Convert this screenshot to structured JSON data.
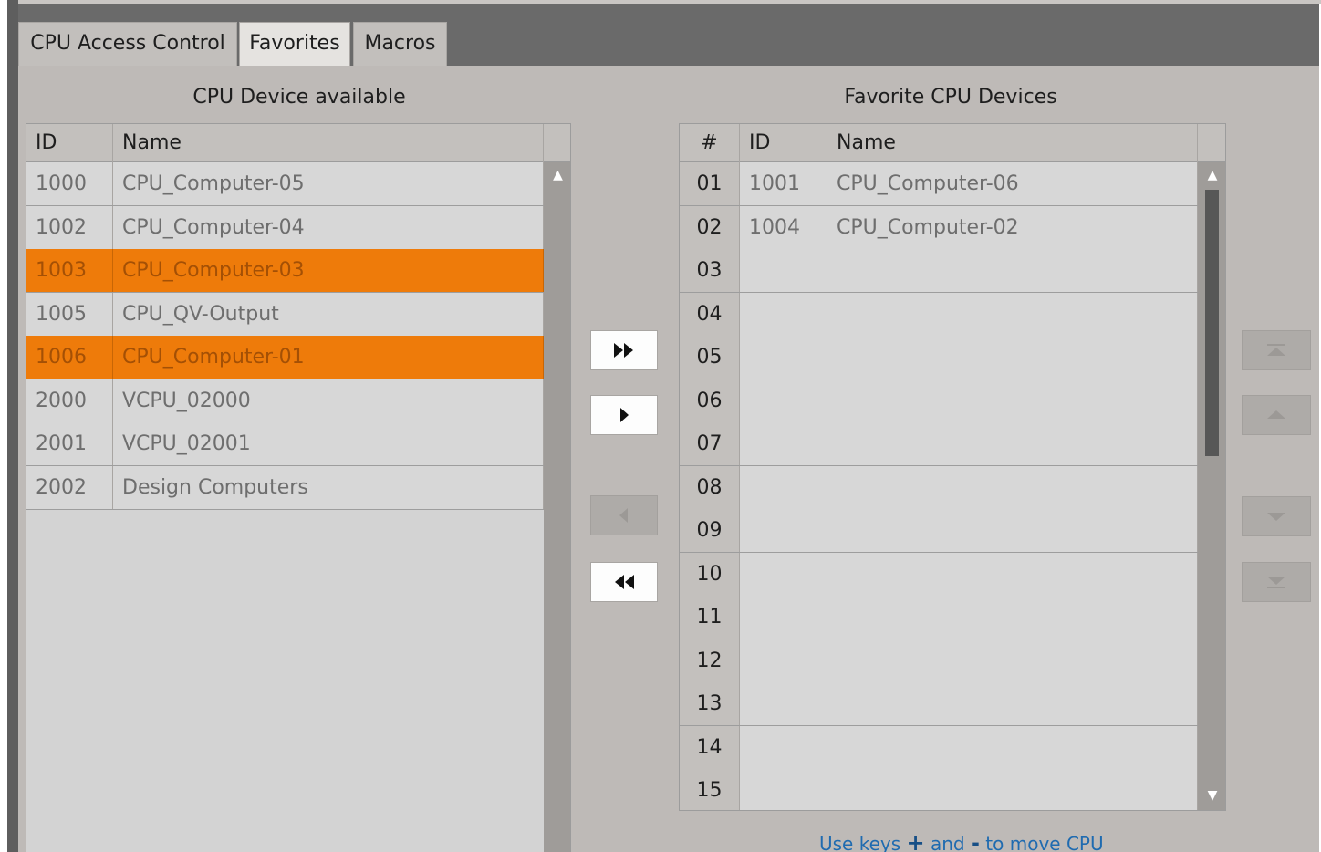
{
  "tabs": [
    {
      "label": "CPU Access Control",
      "active": false
    },
    {
      "label": "Favorites",
      "active": true
    },
    {
      "label": "Macros",
      "active": false
    }
  ],
  "available": {
    "title": "CPU Device available",
    "columns": [
      "ID",
      "Name"
    ],
    "rows": [
      {
        "id": "1000",
        "name": "CPU_Computer-05",
        "selected": false
      },
      {
        "id": "1002",
        "name": "CPU_Computer-04",
        "selected": false
      },
      {
        "id": "1003",
        "name": "CPU_Computer-03",
        "selected": true
      },
      {
        "id": "1005",
        "name": "CPU_QV-Output",
        "selected": false
      },
      {
        "id": "1006",
        "name": "CPU_Computer-01",
        "selected": true
      },
      {
        "id": "2000",
        "name": "VCPU_02000",
        "selected": false
      },
      {
        "id": "2001",
        "name": "VCPU_02001",
        "selected": false
      },
      {
        "id": "2002",
        "name": "Design Computers",
        "selected": false
      }
    ]
  },
  "favorites": {
    "title": "Favorite CPU Devices",
    "columns": [
      "#",
      "ID",
      "Name"
    ],
    "rows": [
      {
        "num": "01",
        "id": "1001",
        "name": "CPU_Computer-06"
      },
      {
        "num": "02",
        "id": "1004",
        "name": "CPU_Computer-02"
      },
      {
        "num": "03",
        "id": "",
        "name": ""
      },
      {
        "num": "04",
        "id": "",
        "name": ""
      },
      {
        "num": "05",
        "id": "",
        "name": ""
      },
      {
        "num": "06",
        "id": "",
        "name": ""
      },
      {
        "num": "07",
        "id": "",
        "name": ""
      },
      {
        "num": "08",
        "id": "",
        "name": ""
      },
      {
        "num": "09",
        "id": "",
        "name": ""
      },
      {
        "num": "10",
        "id": "",
        "name": ""
      },
      {
        "num": "11",
        "id": "",
        "name": ""
      },
      {
        "num": "12",
        "id": "",
        "name": ""
      },
      {
        "num": "13",
        "id": "",
        "name": ""
      },
      {
        "num": "14",
        "id": "",
        "name": ""
      },
      {
        "num": "15",
        "id": "",
        "name": ""
      }
    ]
  },
  "transfer_buttons": [
    {
      "name": "add-all-button",
      "icon": "double-right-arrow-icon",
      "enabled": true
    },
    {
      "name": "add-selected-button",
      "icon": "right-arrow-icon",
      "enabled": true
    },
    {
      "name": "remove-selected-button",
      "icon": "left-arrow-icon",
      "enabled": false
    },
    {
      "name": "remove-all-button",
      "icon": "double-left-arrow-icon",
      "enabled": true
    }
  ],
  "order_buttons": [
    {
      "name": "move-top-button",
      "icon": "move-to-top-icon",
      "enabled": false
    },
    {
      "name": "move-up-button",
      "icon": "move-up-icon",
      "enabled": false
    },
    {
      "name": "move-down-button",
      "icon": "move-down-icon",
      "enabled": false
    },
    {
      "name": "move-bottom-button",
      "icon": "move-to-bottom-icon",
      "enabled": false
    }
  ],
  "hint": {
    "prefix": "Use keys ",
    "plus": "+",
    "middle": " and ",
    "minus": "-",
    "suffix": " to move CPU"
  },
  "colors": {
    "selection": "#ee7b0a",
    "hint": "#1f6bb0"
  }
}
